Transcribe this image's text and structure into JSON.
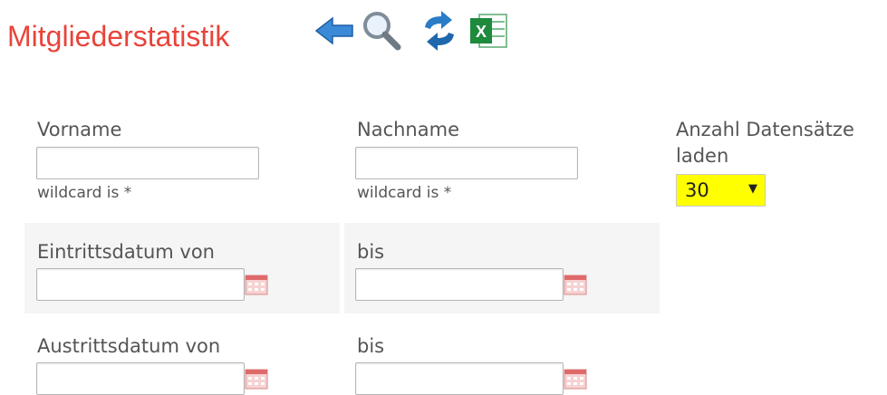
{
  "page": {
    "title": "Mitgliederstatistik"
  },
  "toolbar": {
    "icons": [
      "back-arrow-icon",
      "search-icon",
      "refresh-icon",
      "excel-export-icon"
    ],
    "colors": {
      "arrow": "#2f7fd0",
      "refresh": "#1f6fb8",
      "excel": "#1e8a3c"
    }
  },
  "form": {
    "vorname_label": "Vorname",
    "vorname_hint": "wildcard is *",
    "nachname_label": "Nachname",
    "nachname_hint": "wildcard is *",
    "anzahl_label_line1": "Anzahl Datensätze",
    "anzahl_label_line2": "laden",
    "anzahl_value": "30",
    "eintritt_von_label": "Eintrittsdatum von",
    "eintritt_bis_label": "bis",
    "austritt_von_label": "Austrittsdatum von",
    "austritt_bis_label": "bis"
  },
  "colors": {
    "title": "#e8443a",
    "select_bg": "#ffff00",
    "band_bg": "#f5f5f5"
  }
}
